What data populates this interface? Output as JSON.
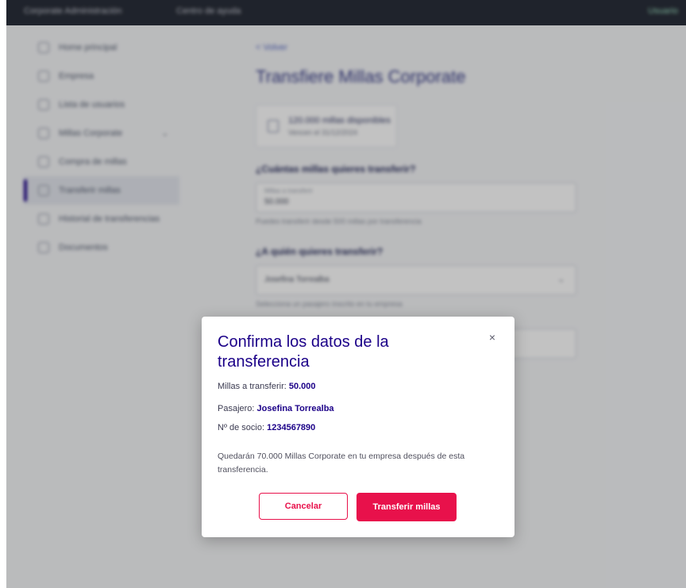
{
  "background": {
    "topbar": {
      "brand": "Corporate  Administración",
      "nav": "Centro de ayuda",
      "user": "Usuario"
    },
    "sidebar": {
      "items": [
        {
          "label": "Home principal"
        },
        {
          "label": "Empresa"
        },
        {
          "label": "Lista de usuarios"
        },
        {
          "label": "Millas Corporate"
        },
        {
          "label": "Compra de millas"
        },
        {
          "label": "Transferir millas"
        },
        {
          "label": "Historial de transferencias"
        },
        {
          "label": "Documentos"
        }
      ]
    },
    "main": {
      "back_label": "< Volver",
      "title": "Transfiere Millas Corporate",
      "balance_line1": "120.000 millas disponibles",
      "balance_line2": "Vencen el 31/12/2024",
      "question1": "¿Cuántas millas quieres transferir?",
      "field1_label": "Millas a transferir",
      "field1_value": "50.000",
      "hint1": "Puedes transferir desde 500 millas por transferencia",
      "question2": "¿A quién quieres transferir?",
      "field2_value": "Josefina Torrealba",
      "hint2": "Selecciona un pasajero inscrito en tu empresa"
    }
  },
  "modal": {
    "title": "Confirma los datos de la transferencia",
    "miles_label": "Millas a transferir: ",
    "miles_value": "50.000",
    "passenger_label": "Pasajero: ",
    "passenger_value": "Josefina Torrealba",
    "member_label": "Nº de socio: ",
    "member_value": "1234567890",
    "note": "Quedarán 70.000 Millas Corporate en tu empresa después de esta transferencia.",
    "close_symbol": "×",
    "cancel_label": "Cancelar",
    "confirm_label": "Transferir millas"
  },
  "colors": {
    "accent": "#e8114b",
    "brand": "#1b0088"
  }
}
